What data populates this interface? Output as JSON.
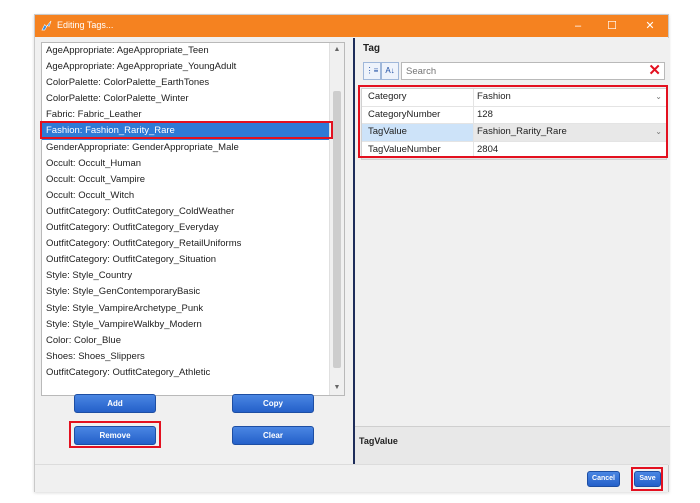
{
  "window": {
    "title": "Editing Tags...",
    "controls": {
      "minimize": "–",
      "maximize": "☐",
      "close": "✕"
    }
  },
  "tags_list": {
    "items": [
      "AgeAppropriate: AgeAppropriate_Teen",
      "AgeAppropriate: AgeAppropriate_YoungAdult",
      "ColorPalette: ColorPalette_EarthTones",
      "ColorPalette: ColorPalette_Winter",
      "Fabric: Fabric_Leather",
      "Fashion: Fashion_Rarity_Rare",
      "GenderAppropriate: GenderAppropriate_Male",
      "Occult: Occult_Human",
      "Occult: Occult_Vampire",
      "Occult: Occult_Witch",
      "OutfitCategory: OutfitCategory_ColdWeather",
      "OutfitCategory: OutfitCategory_Everyday",
      "OutfitCategory: OutfitCategory_RetailUniforms",
      "OutfitCategory: OutfitCategory_Situation",
      "Style: Style_Country",
      "Style: Style_GenContemporaryBasic",
      "Style: Style_VampireArchetype_Punk",
      "Style: Style_VampireWalkby_Modern",
      "Color: Color_Blue",
      "Shoes: Shoes_Slippers",
      "OutfitCategory: OutfitCategory_Athletic"
    ],
    "selected_index": 5
  },
  "buttons": {
    "add": "Add",
    "copy": "Copy",
    "remove": "Remove",
    "clear": "Clear",
    "cancel": "Cancel",
    "save": "Save"
  },
  "tag_panel": {
    "header": "Tag",
    "search_placeholder": "Search",
    "toolbar_icons": [
      "categorized-sort-icon",
      "alphabetical-sort-icon"
    ],
    "properties": [
      {
        "key": "Category",
        "value": "Fashion",
        "dropdown": true
      },
      {
        "key": "CategoryNumber",
        "value": "128",
        "dropdown": false
      },
      {
        "key": "TagValue",
        "value": "Fashion_Rarity_Rare",
        "dropdown": true
      },
      {
        "key": "TagValueNumber",
        "value": "2804",
        "dropdown": false
      }
    ],
    "selected_property_index": 2,
    "description_title": "TagValue"
  },
  "colors": {
    "titlebar": "#f58220",
    "selection": "#2f7ad6",
    "highlight_box": "#e3101f",
    "button_blue": "#2460c9"
  }
}
